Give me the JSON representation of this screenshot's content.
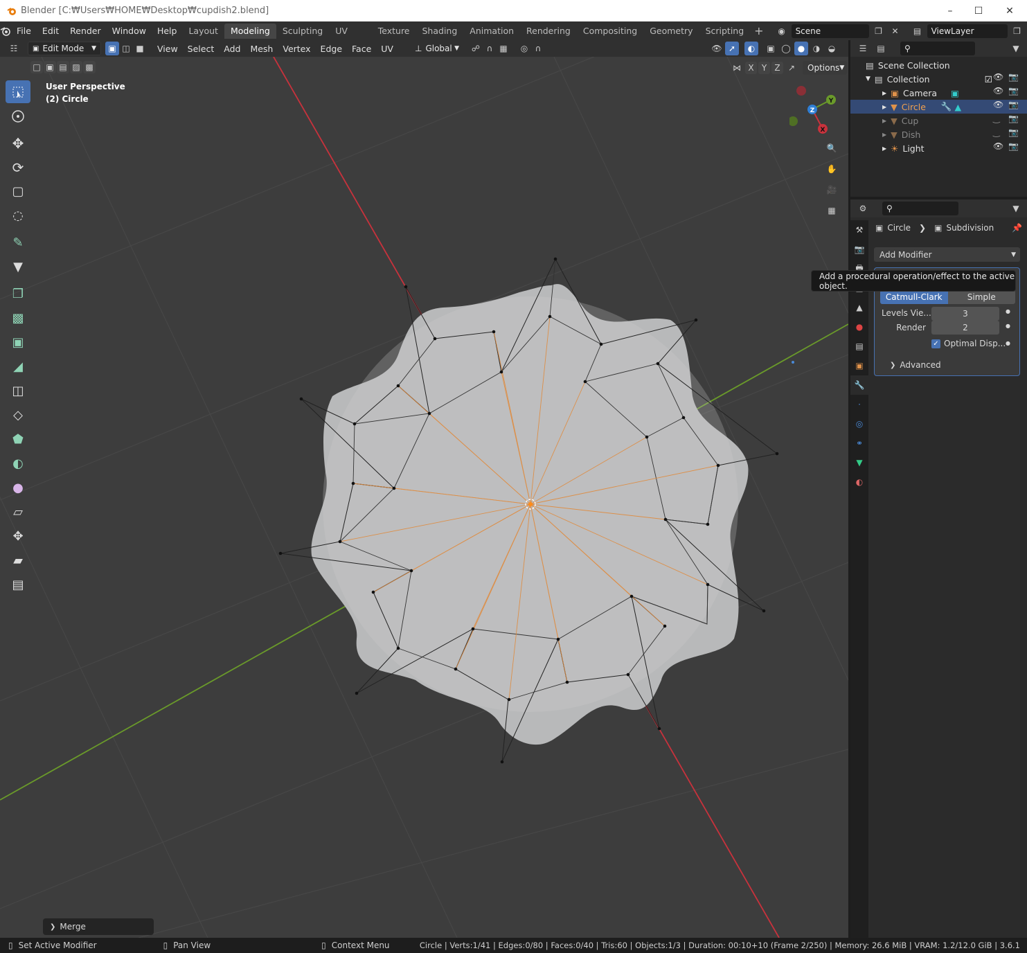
{
  "window": {
    "title": "Blender [C:₩Users₩HOME₩Desktop₩cupdish2.blend]"
  },
  "menu": [
    "File",
    "Edit",
    "Render",
    "Window",
    "Help"
  ],
  "workspaces": [
    "Layout",
    "Modeling",
    "Sculpting",
    "UV Editing",
    "Texture Paint",
    "Shading",
    "Animation",
    "Rendering",
    "Compositing",
    "Geometry Nodes",
    "Scripting"
  ],
  "active_workspace": "Modeling",
  "scene": {
    "name": "Scene",
    "view_layer": "ViewLayer"
  },
  "header": {
    "mode": "Edit Mode",
    "menus": [
      "View",
      "Select",
      "Add",
      "Mesh",
      "Vertex",
      "Edge",
      "Face",
      "UV"
    ],
    "transform_orientation": "Global",
    "axes": [
      "X",
      "Y",
      "Z"
    ],
    "options_label": "Options"
  },
  "viewport": {
    "view_name": "User Perspective",
    "object_label": "(2) Circle",
    "gizmo": {
      "x": "X",
      "y": "Y",
      "z": "Z"
    },
    "last_op": "Merge"
  },
  "outliner": {
    "root": "Scene Collection",
    "collection": "Collection",
    "objects": [
      {
        "name": "Camera",
        "selected": false,
        "dim": false
      },
      {
        "name": "Circle",
        "selected": true,
        "dim": false
      },
      {
        "name": "Cup",
        "selected": false,
        "dim": true
      },
      {
        "name": "Dish",
        "selected": false,
        "dim": true
      },
      {
        "name": "Light",
        "selected": false,
        "dim": false
      }
    ]
  },
  "properties": {
    "breadcrumb_object": "Circle",
    "breadcrumb_modifier": "Subdivision",
    "add_modifier_label": "Add Modifier",
    "tooltip": "Add a procedural operation/effect to the active object.",
    "modes": [
      "Catmull-Clark",
      "Simple"
    ],
    "levels_label": "Levels Vie...",
    "levels_value": "3",
    "render_label": "Render",
    "render_value": "2",
    "optimal_label": "Optimal Disp...",
    "advanced_label": "Advanced"
  },
  "status": {
    "left1": "Set Active Modifier",
    "left2": "Pan View",
    "left3": "Context Menu",
    "stats": "Circle | Verts:1/41 | Edges:0/80 | Faces:0/40 | Tris:60 | Objects:1/3 | Duration: 00:10+10 (Frame 2/250) | Memory: 26.6 MiB | VRAM: 1.2/12.0 GiB | 3.6.1"
  },
  "colors": {
    "accent": "#4772b3",
    "x_axis": "#c8323c",
    "y_axis": "#6a9a2a",
    "z_axis": "#2f7fd6",
    "orange": "#e08a3c"
  }
}
